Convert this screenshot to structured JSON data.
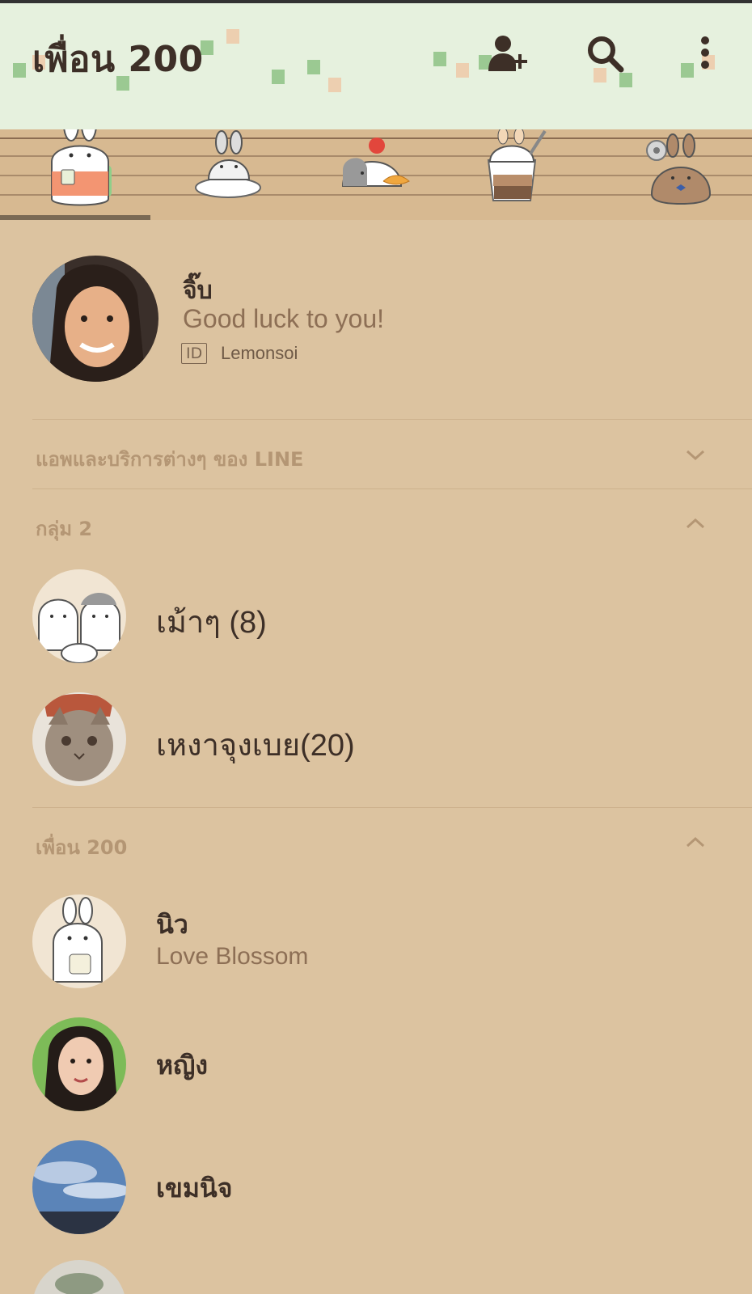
{
  "header": {
    "title": "เพื่อน 200"
  },
  "tabs": [
    "rabbit-drinking-tea",
    "rabbit-on-plate",
    "rabbit-with-cherry",
    "rabbit-parfait",
    "rabbit-settings"
  ],
  "profile": {
    "name": "จิ๊บ",
    "status": "Good luck to you!",
    "id_badge": "ID",
    "id": "Lemonsoi"
  },
  "sections": {
    "apps": "แอพและบริการต่างๆ ของ LINE",
    "groups": "กลุ่ม 2",
    "friends": "เพื่อน 200"
  },
  "groups": [
    {
      "name": "เม้าๆ (8)"
    },
    {
      "name": "เหงาจุงเบย(20)"
    }
  ],
  "friends": [
    {
      "name": "นิว",
      "status": "Love Blossom"
    },
    {
      "name": "หญิง"
    },
    {
      "name": "เขมนิจ"
    }
  ],
  "colors": {
    "background": "#dcc3a0",
    "header": "#e6f1de",
    "shelf": "#d7b991",
    "text": "#3d2f27",
    "section_label": "#b49674"
  }
}
